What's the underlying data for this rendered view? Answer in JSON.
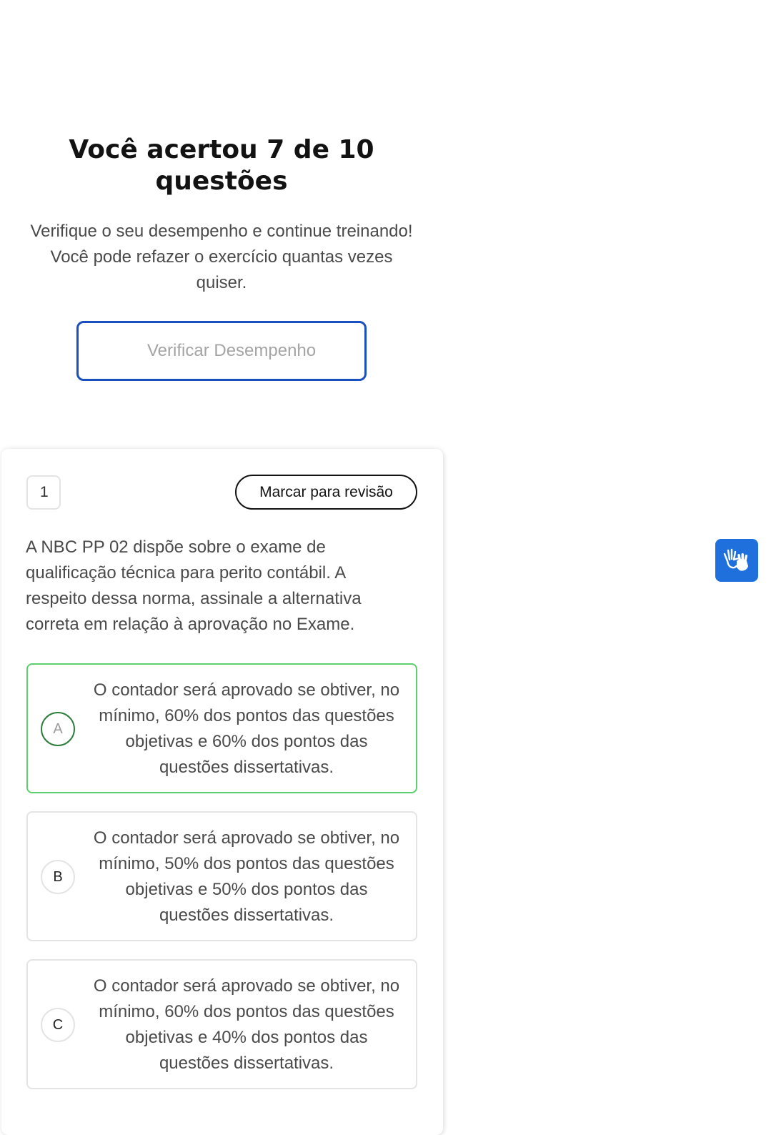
{
  "result": {
    "title": "Você acertou 7 de 10 questões",
    "subtitle": "Verifique o seu desempenho e continue treinando! Você pode refazer o exercício quantas vezes quiser.",
    "performance_button_label": "Verificar Desempenho"
  },
  "question": {
    "number": "1",
    "review_button_label": "Marcar para revisão",
    "text": "A NBC PP 02 dispõe sobre o exame de qualificação técnica para perito contábil. A respeito dessa norma, assinale a alternativa correta em relação à aprovação no Exame.",
    "alternatives": [
      {
        "letter": "A",
        "text": "O contador será aprovado se obtiver, no mínimo, 60% dos pontos das questões objetivas e 60% dos pontos das questões dissertativas.",
        "state": "correct"
      },
      {
        "letter": "B",
        "text": "O contador será aprovado se obtiver, no mínimo, 50% dos pontos das questões objetivas e 50% dos pontos das questões dissertativas.",
        "state": "default"
      },
      {
        "letter": "C",
        "text": "O contador será aprovado se obtiver, no mínimo, 60% dos pontos das questões objetivas e 40% dos pontos das questões dissertativas.",
        "state": "default"
      }
    ]
  },
  "accessibility_widget": {
    "icon": "sign-language-hands-icon"
  },
  "colors": {
    "accent_blue": "#1a4fbf",
    "correct_green": "#5ccf6f",
    "widget_blue": "#1f6fdc"
  }
}
